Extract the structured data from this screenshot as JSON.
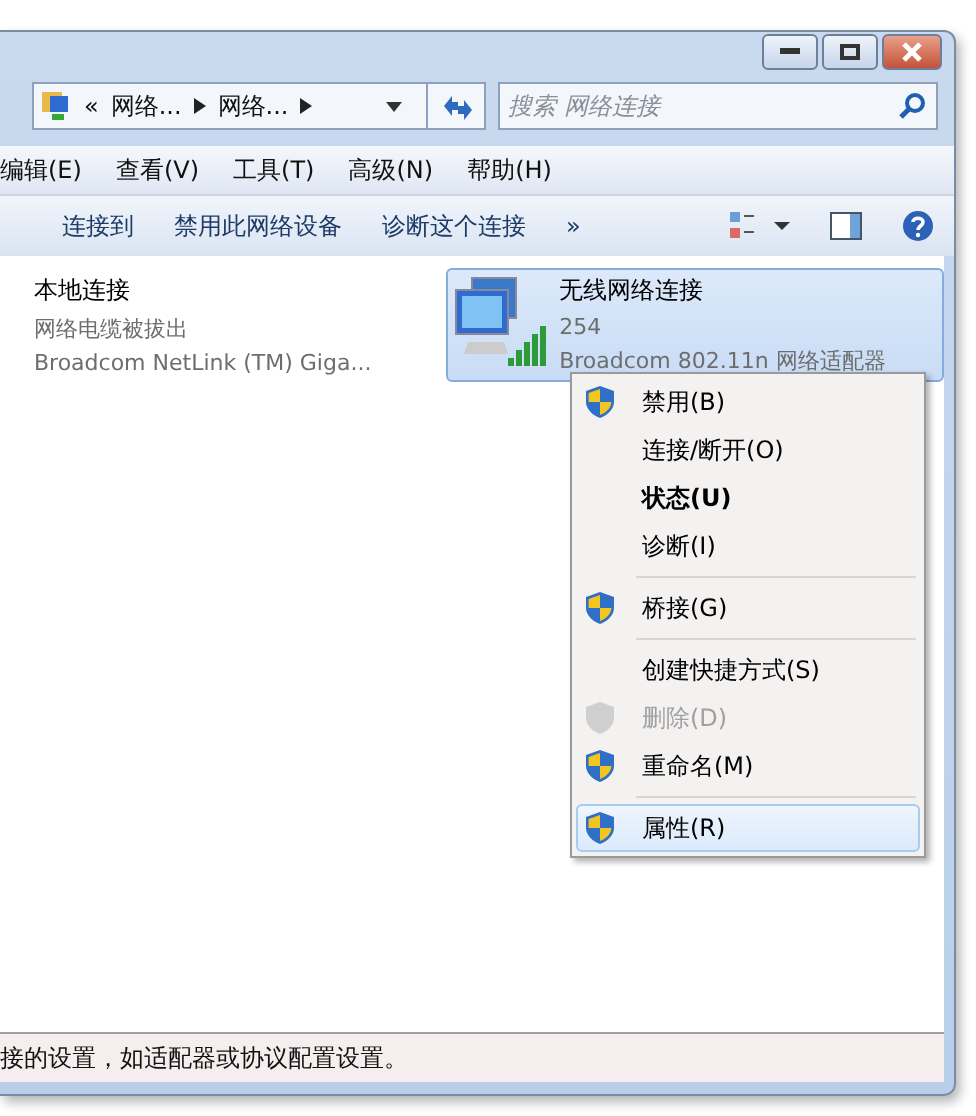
{
  "address_bar": {
    "overflow": "«",
    "crumbs": [
      "网络...",
      "网络..."
    ]
  },
  "search": {
    "placeholder": "搜索 网络连接"
  },
  "menu_bar": [
    "编辑(E)",
    "查看(V)",
    "工具(T)",
    "高级(N)",
    "帮助(H)"
  ],
  "toolbar": [
    "连接到",
    "禁用此网络设备",
    "诊断这个连接",
    "»"
  ],
  "connections": [
    {
      "name": "本地连接",
      "status": "网络电缆被拔出",
      "device": "Broadcom NetLink (TM) Giga...",
      "selected": false,
      "kind": "wired"
    },
    {
      "name": "无线网络连接",
      "status": "254",
      "device": "Broadcom 802.11n 网络适配器",
      "selected": true,
      "kind": "wireless"
    }
  ],
  "context_menu": [
    {
      "kind": "item",
      "label": "禁用(B)",
      "shield": true,
      "bold": false,
      "disabled": false,
      "selected": false
    },
    {
      "kind": "item",
      "label": "连接/断开(O)",
      "shield": false,
      "bold": false,
      "disabled": false,
      "selected": false
    },
    {
      "kind": "item",
      "label": "状态(U)",
      "shield": false,
      "bold": true,
      "disabled": false,
      "selected": false
    },
    {
      "kind": "item",
      "label": "诊断(I)",
      "shield": false,
      "bold": false,
      "disabled": false,
      "selected": false
    },
    {
      "kind": "separator"
    },
    {
      "kind": "item",
      "label": "桥接(G)",
      "shield": true,
      "bold": false,
      "disabled": false,
      "selected": false
    },
    {
      "kind": "separator"
    },
    {
      "kind": "item",
      "label": "创建快捷方式(S)",
      "shield": false,
      "bold": false,
      "disabled": false,
      "selected": false
    },
    {
      "kind": "item",
      "label": "删除(D)",
      "shield": true,
      "bold": false,
      "disabled": true,
      "selected": false
    },
    {
      "kind": "item",
      "label": "重命名(M)",
      "shield": true,
      "bold": false,
      "disabled": false,
      "selected": false
    },
    {
      "kind": "separator"
    },
    {
      "kind": "item",
      "label": "属性(R)",
      "shield": true,
      "bold": false,
      "disabled": false,
      "selected": true
    }
  ],
  "status_bar": "接的设置，如适配器或协议配置设置。"
}
